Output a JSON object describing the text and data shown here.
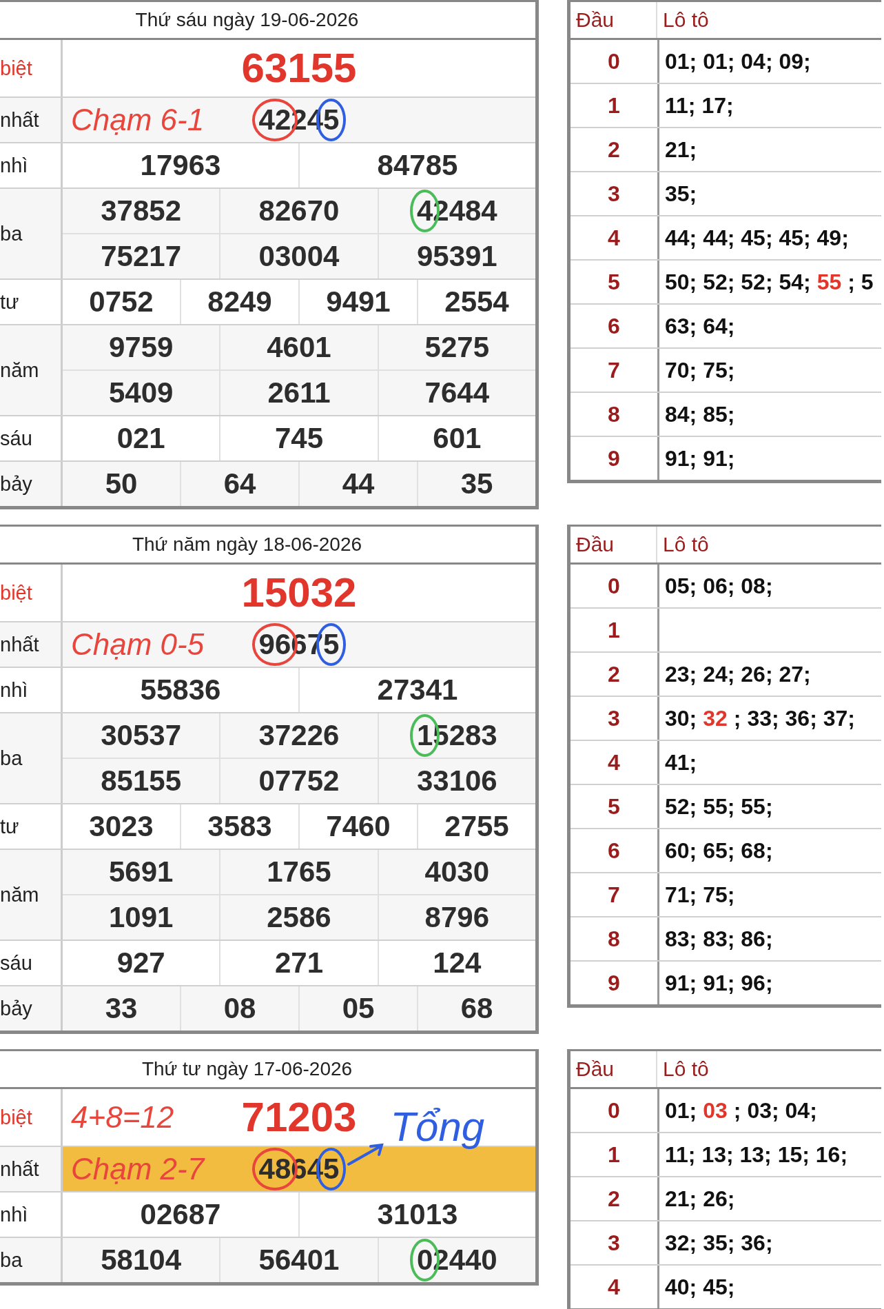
{
  "draws": [
    {
      "title": "Thứ sáu ngày 19-06-2026",
      "prizes": [
        {
          "label": "biệt",
          "kind": "special",
          "highlighted": false,
          "rows": [
            [
              {
                "value": "63155"
              }
            ]
          ]
        },
        {
          "label": "nhất",
          "kind": "normal",
          "highlighted": false,
          "note": "Chạm 6-1",
          "rows": [
            [
              {
                "value": "42245",
                "marks": [
                  {
                    "kind": "front",
                    "color": "#e8453c"
                  },
                  {
                    "kind": "last",
                    "color": "#2f5fe0"
                  }
                ]
              }
            ]
          ]
        },
        {
          "label": "nhì",
          "kind": "normal",
          "highlighted": false,
          "rows": [
            [
              {
                "value": "17963"
              },
              {
                "value": "84785"
              }
            ]
          ]
        },
        {
          "label": "ba",
          "kind": "normal",
          "highlighted": false,
          "rows": [
            [
              {
                "value": "37852"
              },
              {
                "value": "82670"
              },
              {
                "value": "42484",
                "marks": [
                  {
                    "kind": "first",
                    "color": "#4cbb5a"
                  }
                ]
              }
            ],
            [
              {
                "value": "75217"
              },
              {
                "value": "03004"
              },
              {
                "value": "95391"
              }
            ]
          ]
        },
        {
          "label": "tư",
          "kind": "normal",
          "highlighted": false,
          "rows": [
            [
              {
                "value": "0752"
              },
              {
                "value": "8249"
              },
              {
                "value": "9491"
              },
              {
                "value": "2554"
              }
            ]
          ]
        },
        {
          "label": "năm",
          "kind": "normal",
          "highlighted": false,
          "rows": [
            [
              {
                "value": "9759"
              },
              {
                "value": "4601"
              },
              {
                "value": "5275"
              }
            ],
            [
              {
                "value": "5409"
              },
              {
                "value": "2611"
              },
              {
                "value": "7644"
              }
            ]
          ]
        },
        {
          "label": "sáu",
          "kind": "normal",
          "highlighted": false,
          "rows": [
            [
              {
                "value": "021"
              },
              {
                "value": "745"
              },
              {
                "value": "601"
              }
            ]
          ]
        },
        {
          "label": "bảy",
          "kind": "normal",
          "highlighted": false,
          "rows": [
            [
              {
                "value": "50"
              },
              {
                "value": "64"
              },
              {
                "value": "44"
              },
              {
                "value": "35"
              }
            ]
          ]
        }
      ],
      "loto": {
        "headers": [
          "Đầu",
          "Lô tô"
        ],
        "rows": [
          {
            "head": "0",
            "parts": [
              {
                "text": "01; 01; 04; 09;",
                "highlight": false
              }
            ]
          },
          {
            "head": "1",
            "parts": [
              {
                "text": "11; 17;",
                "highlight": false
              }
            ]
          },
          {
            "head": "2",
            "parts": [
              {
                "text": "21;",
                "highlight": false
              }
            ]
          },
          {
            "head": "3",
            "parts": [
              {
                "text": "35;",
                "highlight": false
              }
            ]
          },
          {
            "head": "4",
            "parts": [
              {
                "text": "44; 44; 45; 45; 49;",
                "highlight": false
              }
            ]
          },
          {
            "head": "5",
            "parts": [
              {
                "text": "50; 52; 52; 54;",
                "highlight": false
              },
              {
                "text": "55",
                "highlight": true
              },
              {
                "text": "; 5",
                "highlight": false
              }
            ]
          },
          {
            "head": "6",
            "parts": [
              {
                "text": "63; 64;",
                "highlight": false
              }
            ]
          },
          {
            "head": "7",
            "parts": [
              {
                "text": "70; 75;",
                "highlight": false
              }
            ]
          },
          {
            "head": "8",
            "parts": [
              {
                "text": "84; 85;",
                "highlight": false
              }
            ]
          },
          {
            "head": "9",
            "parts": [
              {
                "text": "91; 91;",
                "highlight": false
              }
            ]
          }
        ]
      }
    },
    {
      "title": "Thứ năm ngày 18-06-2026",
      "prizes": [
        {
          "label": "biệt",
          "kind": "special",
          "highlighted": false,
          "rows": [
            [
              {
                "value": "15032"
              }
            ]
          ]
        },
        {
          "label": "nhất",
          "kind": "normal",
          "highlighted": false,
          "note": "Chạm 0-5",
          "rows": [
            [
              {
                "value": "96675",
                "marks": [
                  {
                    "kind": "front",
                    "color": "#e8453c"
                  },
                  {
                    "kind": "last",
                    "color": "#2f5fe0"
                  }
                ]
              }
            ]
          ]
        },
        {
          "label": "nhì",
          "kind": "normal",
          "highlighted": false,
          "rows": [
            [
              {
                "value": "55836"
              },
              {
                "value": "27341"
              }
            ]
          ]
        },
        {
          "label": "ba",
          "kind": "normal",
          "highlighted": false,
          "rows": [
            [
              {
                "value": "30537"
              },
              {
                "value": "37226"
              },
              {
                "value": "15283",
                "marks": [
                  {
                    "kind": "first",
                    "color": "#4cbb5a"
                  }
                ]
              }
            ],
            [
              {
                "value": "85155"
              },
              {
                "value": "07752"
              },
              {
                "value": "33106"
              }
            ]
          ]
        },
        {
          "label": "tư",
          "kind": "normal",
          "highlighted": false,
          "rows": [
            [
              {
                "value": "3023"
              },
              {
                "value": "3583"
              },
              {
                "value": "7460"
              },
              {
                "value": "2755"
              }
            ]
          ]
        },
        {
          "label": "năm",
          "kind": "normal",
          "highlighted": false,
          "rows": [
            [
              {
                "value": "5691"
              },
              {
                "value": "1765"
              },
              {
                "value": "4030"
              }
            ],
            [
              {
                "value": "1091"
              },
              {
                "value": "2586"
              },
              {
                "value": "8796"
              }
            ]
          ]
        },
        {
          "label": "sáu",
          "kind": "normal",
          "highlighted": false,
          "rows": [
            [
              {
                "value": "927"
              },
              {
                "value": "271"
              },
              {
                "value": "124"
              }
            ]
          ]
        },
        {
          "label": "bảy",
          "kind": "normal",
          "highlighted": false,
          "rows": [
            [
              {
                "value": "33"
              },
              {
                "value": "08"
              },
              {
                "value": "05"
              },
              {
                "value": "68"
              }
            ]
          ]
        }
      ],
      "loto": {
        "headers": [
          "Đầu",
          "Lô tô"
        ],
        "rows": [
          {
            "head": "0",
            "parts": [
              {
                "text": "05; 06; 08;",
                "highlight": false
              }
            ]
          },
          {
            "head": "1",
            "parts": []
          },
          {
            "head": "2",
            "parts": [
              {
                "text": "23; 24; 26; 27;",
                "highlight": false
              }
            ]
          },
          {
            "head": "3",
            "parts": [
              {
                "text": "30;",
                "highlight": false
              },
              {
                "text": "32",
                "highlight": true
              },
              {
                "text": "; 33; 36; 37;",
                "highlight": false
              }
            ]
          },
          {
            "head": "4",
            "parts": [
              {
                "text": "41;",
                "highlight": false
              }
            ]
          },
          {
            "head": "5",
            "parts": [
              {
                "text": "52; 55; 55;",
                "highlight": false
              }
            ]
          },
          {
            "head": "6",
            "parts": [
              {
                "text": "60; 65; 68;",
                "highlight": false
              }
            ]
          },
          {
            "head": "7",
            "parts": [
              {
                "text": "71; 75;",
                "highlight": false
              }
            ]
          },
          {
            "head": "8",
            "parts": [
              {
                "text": "83; 83; 86;",
                "highlight": false
              }
            ]
          },
          {
            "head": "9",
            "parts": [
              {
                "text": "91; 91; 96;",
                "highlight": false
              }
            ]
          }
        ]
      }
    },
    {
      "title": "Thứ tư ngày 17-06-2026",
      "prizes": [
        {
          "label": "biệt",
          "kind": "special",
          "highlighted": false,
          "note": "4+8=12",
          "rows": [
            [
              {
                "value": "71203"
              }
            ]
          ]
        },
        {
          "label": "nhất",
          "kind": "normal",
          "highlighted": true,
          "note": "Chạm 2-7",
          "callout": "Tổng",
          "rows": [
            [
              {
                "value": "48645",
                "marks": [
                  {
                    "kind": "front",
                    "color": "#e8453c"
                  },
                  {
                    "kind": "last",
                    "color": "#2f5fe0"
                  }
                ]
              }
            ]
          ]
        },
        {
          "label": "nhì",
          "kind": "normal",
          "highlighted": false,
          "rows": [
            [
              {
                "value": "02687"
              },
              {
                "value": "31013"
              }
            ]
          ]
        },
        {
          "label": "ba",
          "kind": "normal",
          "highlighted": false,
          "rows": [
            [
              {
                "value": "58104"
              },
              {
                "value": "56401"
              },
              {
                "value": "02440",
                "marks": [
                  {
                    "kind": "first",
                    "color": "#4cbb5a"
                  }
                ]
              }
            ]
          ]
        }
      ],
      "loto": {
        "headers": [
          "Đầu",
          "Lô tô"
        ],
        "rows": [
          {
            "head": "0",
            "parts": [
              {
                "text": "01;",
                "highlight": false
              },
              {
                "text": "03",
                "highlight": true
              },
              {
                "text": "; 03; 04;",
                "highlight": false
              }
            ]
          },
          {
            "head": "1",
            "parts": [
              {
                "text": "11; 13; 13; 15; 16;",
                "highlight": false
              }
            ]
          },
          {
            "head": "2",
            "parts": [
              {
                "text": "21; 26;",
                "highlight": false
              }
            ]
          },
          {
            "head": "3",
            "parts": [
              {
                "text": "32; 35; 36;",
                "highlight": false
              }
            ]
          },
          {
            "head": "4",
            "parts": [
              {
                "text": "40; 45;",
                "highlight": false
              }
            ]
          }
        ]
      }
    }
  ]
}
